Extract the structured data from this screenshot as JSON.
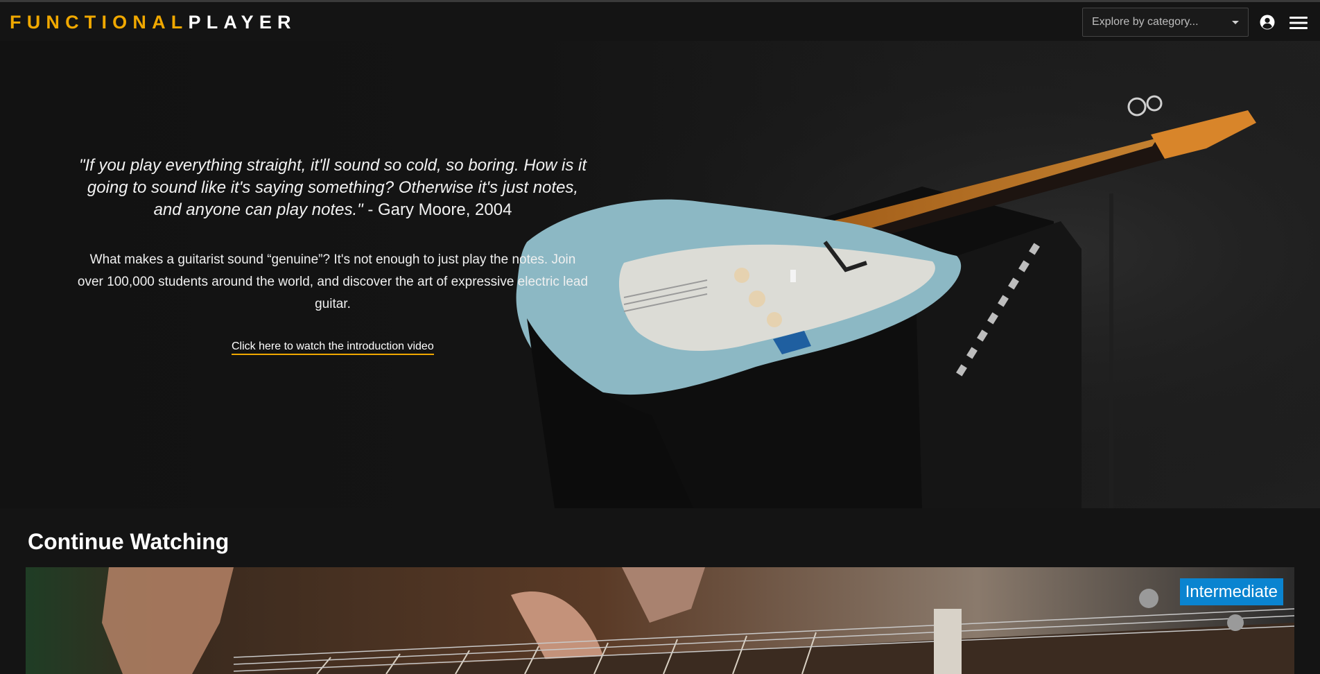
{
  "header": {
    "logo_part1": "FUNCTIONAL",
    "logo_part2": "PLAYER",
    "category_select": {
      "selected": "Explore by category..."
    },
    "user_icon": "user-circle-icon",
    "menu_icon": "hamburger-menu-icon"
  },
  "hero": {
    "quote_text": "\"If you play everything straight, it'll sound so cold, so boring. How is it going to sound like it's saying something? Otherwise it's just notes, and anyone can play notes.\"",
    "quote_attribution": " - Gary Moore, 2004",
    "description": "What makes a guitarist sound “genuine”? It's not enough to just play the notes. Join over 100,000 students around the world, and discover the art of expressive electric lead guitar.",
    "intro_link": "Click here to watch the introduction video"
  },
  "continue_watching": {
    "title": "Continue Watching",
    "card": {
      "level_badge": "Intermediate"
    }
  },
  "colors": {
    "accent": "#f0a800",
    "background": "#141414",
    "badge": "#0a84d0"
  }
}
